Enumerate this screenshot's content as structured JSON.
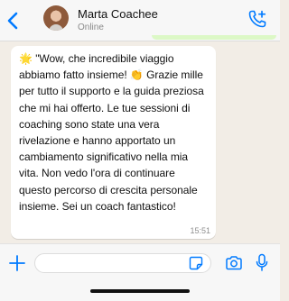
{
  "header": {
    "contact_name": "Marta Coachee",
    "status": "Online"
  },
  "message": {
    "emoji_prefix": "🌟",
    "text": "\"Wow, che incredibile viaggio abbiamo fatto insieme! 👏 Grazie mille per tutto il supporto e la guida preziosa che mi hai offerto. Le tue sessioni di coaching sono state una vera rivelazione e hanno apportato un cambiamento significativo nella mia vita. Non vedo l'ora di continuare questo percorso di crescita personale insieme. Sei un coach fantastico!",
    "time": "15:51"
  },
  "input": {
    "value": "",
    "placeholder": ""
  },
  "icons": {
    "back": "chevron-left-icon",
    "call": "add-call-icon",
    "attach": "plus-icon",
    "sticker": "sticker-icon",
    "camera": "camera-icon",
    "mic": "microphone-icon"
  },
  "colors": {
    "accent": "#007aff",
    "background": "#f2ede6",
    "outgoing_bubble": "#dcf8c6",
    "incoming_bubble": "#ffffff"
  }
}
